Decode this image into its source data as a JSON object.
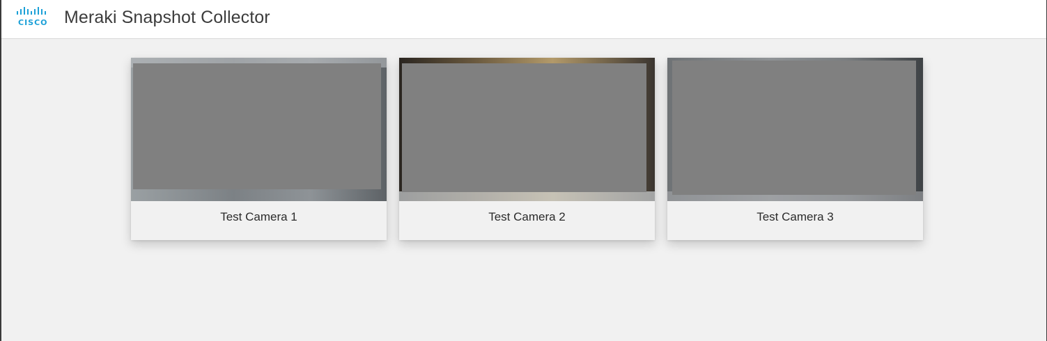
{
  "header": {
    "logo_text": "CISCO",
    "title": "Meraki Snapshot Collector"
  },
  "cameras": [
    {
      "name": "Test Camera 1"
    },
    {
      "name": "Test Camera 2"
    },
    {
      "name": "Test Camera 3"
    }
  ],
  "colors": {
    "brand": "#1ba0d7",
    "background": "#f1f1f1",
    "redaction": "#808080"
  }
}
